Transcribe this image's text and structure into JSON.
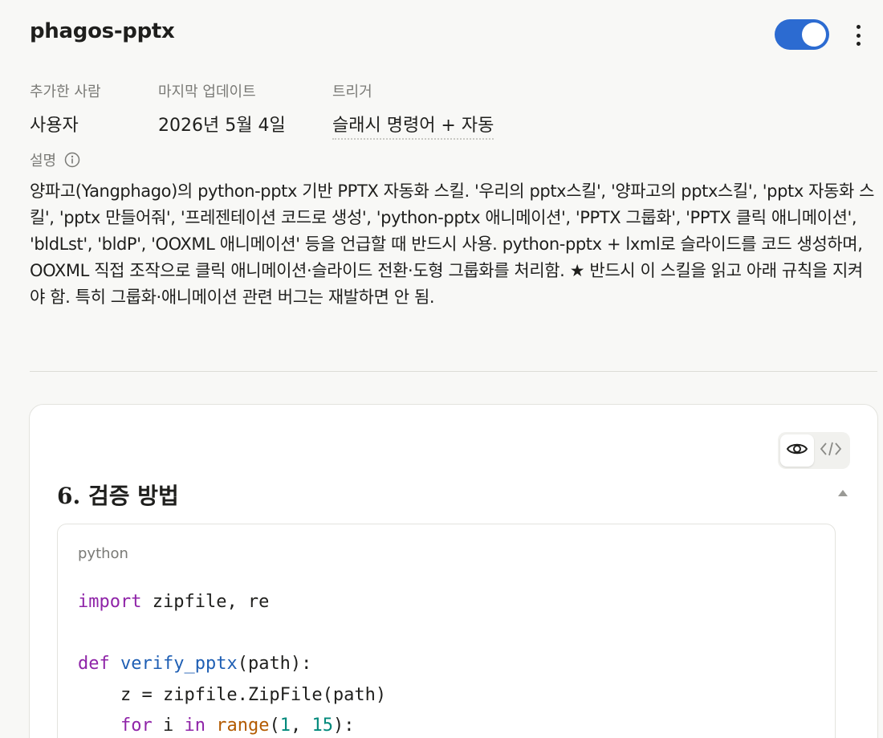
{
  "header": {
    "title": "phagos-pptx",
    "enabled": true
  },
  "meta": {
    "added_by_label": "추가한 사람",
    "added_by_value": "사용자",
    "updated_label": "마지막 업데이트",
    "updated_value": "2026년 5월 4일",
    "trigger_label": "트리거",
    "trigger_value": "슬래시 명령어 + 자동"
  },
  "description": {
    "label": "설명",
    "text": "양파고(Yangphago)의 python-pptx 기반 PPTX 자동화 스킬. '우리의 pptx스킬', '양파고의 pptx스킬', 'pptx 자동화 스킬', 'pptx 만들어줘', '프레젠테이션 코드로 생성', 'python-pptx 애니메이션', 'PPTX 그룹화', 'PPTX 클릭 애니메이션', 'bldLst', 'bldP', 'OOXML 애니메이션' 등을 언급할 때 반드시 사용. python-pptx + lxml로 슬라이드를 코드 생성하며, OOXML 직접 조작으로 클릭 애니메이션·슬라이드 전환·도형 그룹화를 처리함. ★ 반드시 이 스킬을 읽고 아래 규칙을 지켜야 함. 특히 그룹화·애니메이션 관련 버그는 재발하면 안 됨."
  },
  "card": {
    "section_title": "6. 검증 방법",
    "view_modes": [
      "preview",
      "code"
    ],
    "active_view": "preview",
    "code": {
      "language": "python",
      "lines": [
        [
          {
            "t": "import",
            "c": "kw"
          },
          {
            "t": " zipfile, re",
            "c": ""
          }
        ],
        [],
        [
          {
            "t": "def",
            "c": "kw"
          },
          {
            "t": " ",
            "c": ""
          },
          {
            "t": "verify_pptx",
            "c": "fn"
          },
          {
            "t": "(path):",
            "c": ""
          }
        ],
        [
          {
            "t": "    z = zipfile.ZipFile(path)",
            "c": ""
          }
        ],
        [
          {
            "t": "    ",
            "c": ""
          },
          {
            "t": "for",
            "c": "kw"
          },
          {
            "t": " i ",
            "c": ""
          },
          {
            "t": "in",
            "c": "kw"
          },
          {
            "t": " ",
            "c": ""
          },
          {
            "t": "range",
            "c": "bi"
          },
          {
            "t": "(",
            "c": ""
          },
          {
            "t": "1",
            "c": "num"
          },
          {
            "t": ", ",
            "c": ""
          },
          {
            "t": "15",
            "c": "num"
          },
          {
            "t": "):",
            "c": ""
          }
        ]
      ]
    }
  },
  "colors": {
    "toggle_on": "#2c6bd1",
    "keyword": "#8f24a8",
    "function": "#1f5fb4",
    "builtin": "#b35a00",
    "number": "#00897b"
  },
  "icons": [
    "more-vertical-icon",
    "info-icon",
    "eye-icon",
    "code-icon",
    "chevron-up-icon"
  ]
}
